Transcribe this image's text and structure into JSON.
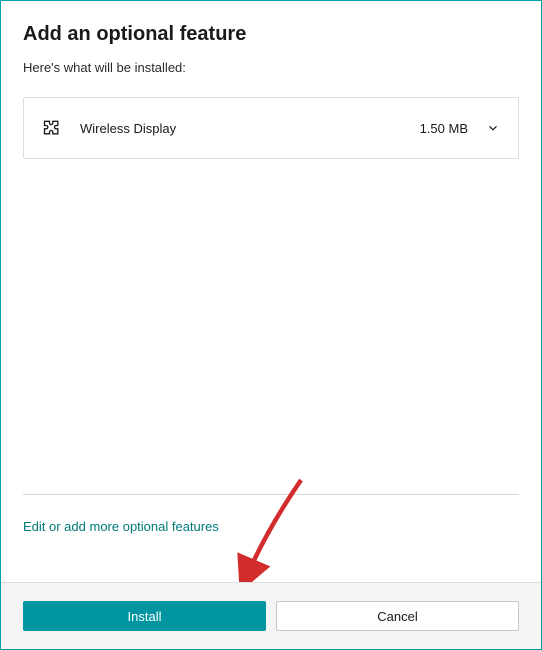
{
  "dialog": {
    "title": "Add an optional feature",
    "subtitle": "Here's what will be installed:"
  },
  "feature": {
    "name": "Wireless Display",
    "size": "1.50 MB"
  },
  "link": {
    "edit_more": "Edit or add more optional features"
  },
  "buttons": {
    "install": "Install",
    "cancel": "Cancel"
  },
  "colors": {
    "accent": "#0095a0",
    "link": "#007a7a",
    "arrow": "#d22c2c"
  }
}
